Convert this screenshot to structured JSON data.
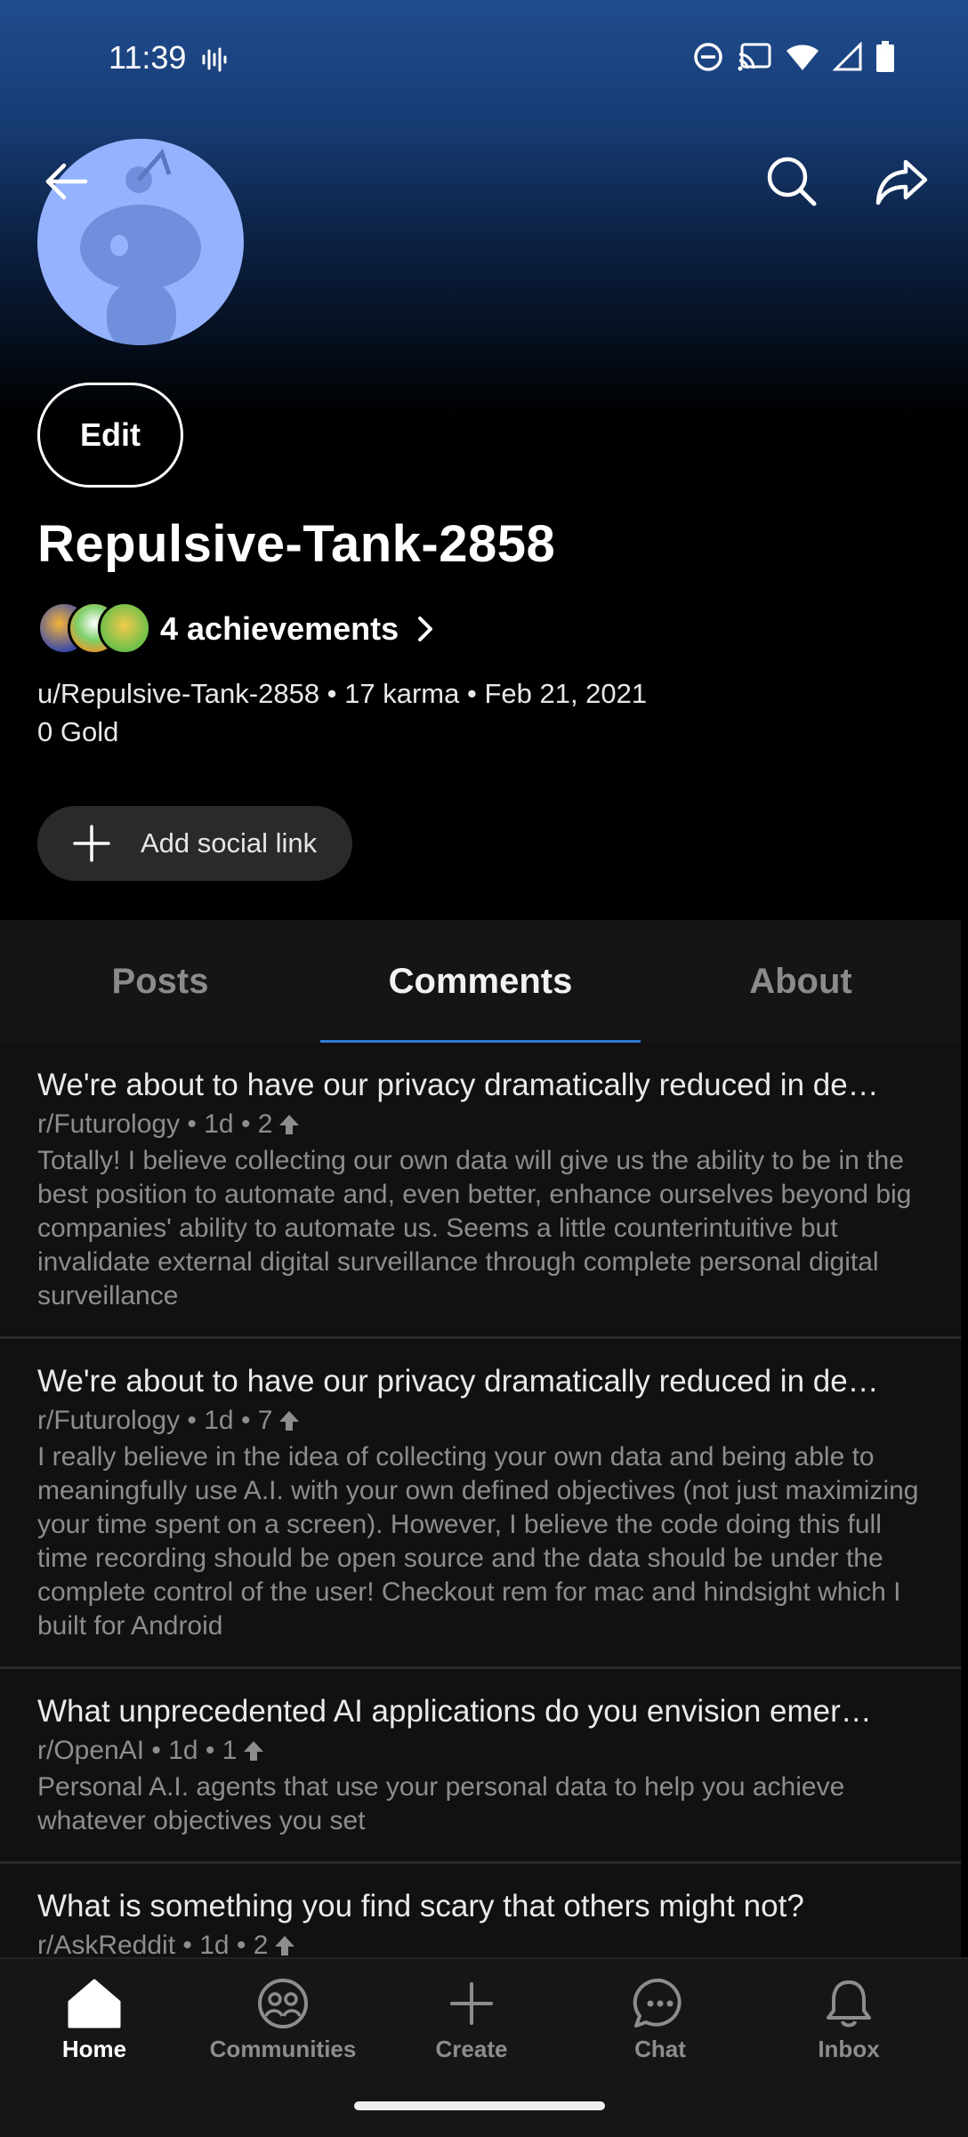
{
  "status_bar": {
    "time": "11:39"
  },
  "profile": {
    "edit_label": "Edit",
    "username": "Repulsive-Tank-2858",
    "achievements_label": "4 achievements",
    "meta_line": "u/Repulsive-Tank-2858 • 17 karma • Feb 21, 2021",
    "gold_line": "0 Gold",
    "social_label": "Add social link"
  },
  "tabs": [
    {
      "label": "Posts",
      "active": false
    },
    {
      "label": "Comments",
      "active": true
    },
    {
      "label": "About",
      "active": false
    }
  ],
  "comments": [
    {
      "title": "We're about to have our privacy dramatically reduced in de…",
      "subreddit_meta": "r/Futurology • 1d • 2",
      "body": "Totally! I believe collecting our own data will give us the ability to be in the best position to automate and, even better, enhance ourselves beyond big companies' ability to automate us. Seems a little counterintuitive but invalidate external digital surveillance through complete personal digital surveillance"
    },
    {
      "title": "We're about to have our privacy dramatically reduced in de…",
      "subreddit_meta": "r/Futurology • 1d • 7",
      "body": "I really believe in the idea of collecting your own data and being able to meaningfully use A.I. with your own defined objectives (not just maximizing your time spent on a screen). However, I believe the code doing this full time recording should be open source and the data should be under the complete control of the user!  Checkout rem for mac and hindsight which I built for Android"
    },
    {
      "title": "What unprecedented AI applications do you envision emer…",
      "subreddit_meta": "r/OpenAI • 1d • 1",
      "body": "Personal A.I. agents that use your personal data to help you achieve whatever objectives you set"
    },
    {
      "title": "What is something you find scary that others might not?",
      "subreddit_meta": "r/AskReddit • 1d • 2",
      "body": ""
    }
  ],
  "nav": [
    {
      "label": "Home",
      "icon": "home-icon",
      "active": true
    },
    {
      "label": "Communities",
      "icon": "communities-icon",
      "active": false
    },
    {
      "label": "Create",
      "icon": "plus-icon",
      "active": false
    },
    {
      "label": "Chat",
      "icon": "chat-icon",
      "active": false
    },
    {
      "label": "Inbox",
      "icon": "bell-icon",
      "active": false
    }
  ],
  "colors": {
    "accent": "#2e7bd6",
    "avatar_bg": "#94b2ff",
    "header_top": "#1f4d8f"
  }
}
